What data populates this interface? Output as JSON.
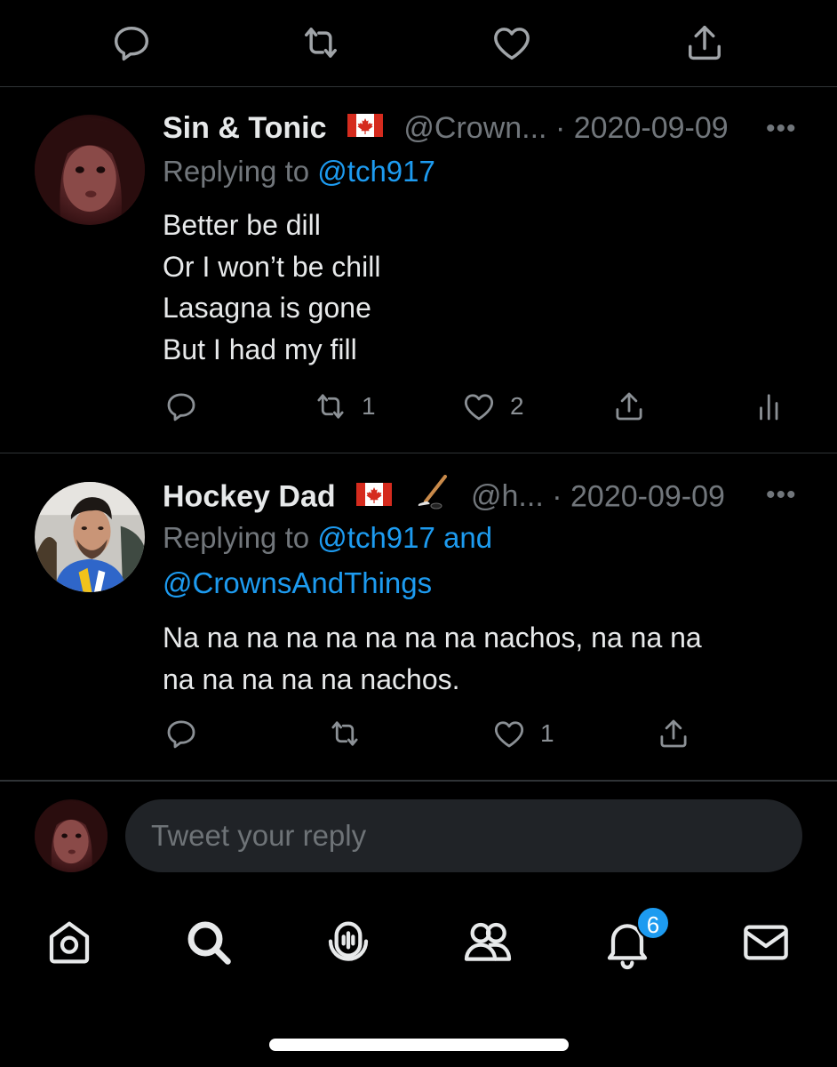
{
  "top_actions": {
    "icons": [
      "reply-icon",
      "retweet-icon",
      "like-icon",
      "share-icon"
    ]
  },
  "tweets": [
    {
      "name": "Sin & Tonic",
      "handle": "@Crown...",
      "separator": "·",
      "date": "2020-09-09",
      "more": "•••",
      "replying_prefix": "Replying to",
      "mentions": "@tch917",
      "mentions_line2": "",
      "text": "Better be dill\nOr I won’t be chill\nLasagna is gone\nBut I had my fill",
      "retweets": "1",
      "likes": "2"
    },
    {
      "name": "Hockey Dad",
      "handle": "@h...",
      "separator": "·",
      "date": "2020-09-09",
      "more": "•••",
      "replying_prefix": "Replying to",
      "mentions": "@tch917 and",
      "mentions_line2": "@CrownsAndThings",
      "text": "Na na na na na na na na nachos, na na na\nna na na na na nachos.",
      "retweets": "",
      "likes": "1"
    }
  ],
  "composer": {
    "placeholder": "Tweet your reply"
  },
  "nav": {
    "items": [
      "home",
      "search",
      "spaces",
      "communities",
      "notifications",
      "messages"
    ],
    "notifications_badge": "6"
  },
  "colors": {
    "background": "#000000",
    "accent": "#1d9bf0",
    "secondary_text": "#71767b"
  }
}
